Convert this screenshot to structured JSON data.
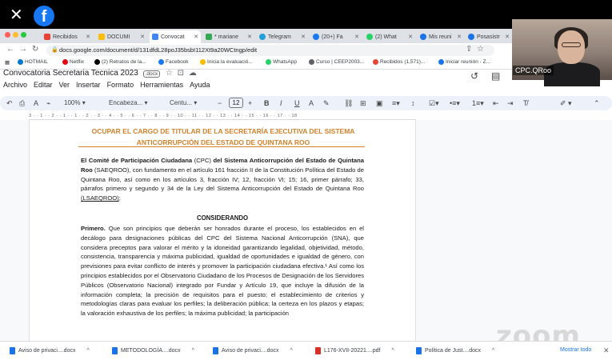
{
  "overlay": {
    "close": "✕",
    "fb_logo": "f"
  },
  "tabs": [
    {
      "label": "Recibidos",
      "color": "#ea4335"
    },
    {
      "label": "DOCUMI",
      "color": "#fbbc04"
    },
    {
      "label": "Convocat",
      "color": "#4285f4",
      "active": true
    },
    {
      "label": "* mariane",
      "color": "#34a853"
    },
    {
      "label": "Telegram",
      "color": "#229ed9"
    },
    {
      "label": "(20+) Fa",
      "color": "#1877f2"
    },
    {
      "label": "(2) What",
      "color": "#25d366"
    },
    {
      "label": "Mis reuni",
      "color": "#1a73e8"
    },
    {
      "label": "Posasistr",
      "color": "#1a73e8"
    }
  ],
  "address": {
    "url": "docs.google.com/document/d/131dfdL28poJ35bsbI112Xt9a20WCtngp/edit"
  },
  "bookmarks": [
    {
      "label": "HOTMAIL",
      "color": "#0078d4"
    },
    {
      "label": "Netflix",
      "color": "#e50914"
    },
    {
      "label": "(2) Retratos de la...",
      "color": "#000000"
    },
    {
      "label": "Facebook",
      "color": "#1877f2"
    },
    {
      "label": "Inicia la evaluació...",
      "color": "#fbbc04"
    },
    {
      "label": "WhatsApp",
      "color": "#25d366"
    },
    {
      "label": "Curso | CEEP2003...",
      "color": "#5f6368"
    },
    {
      "label": "Recibidos (1,571)...",
      "color": "#ea4335"
    },
    {
      "label": "Iniciar reunión - Z...",
      "color": "#1a73e8"
    }
  ],
  "webcam": {
    "name": "CPC.QRoo"
  },
  "docs": {
    "title": "Convocatoria Secretaria Tecnica 2023",
    "badge": ".docx",
    "menu": [
      "Archivo",
      "Editar",
      "Ver",
      "Insertar",
      "Formato",
      "Herramientas",
      "Ayuda"
    ]
  },
  "toolbar": {
    "zoom": "100%",
    "style": "Encabeza...",
    "font": "Centu...",
    "font_size": "12"
  },
  "ruler": "3 · · 1 · · 2 · · 1 · · 1 · · 2 · · 3 · · 4 · · 5 · · 6 · · 7 · · 8 · · 9 · · 10 · · 11 · · 12 · · 13 · · 14 · · 15 · · 16 · · 17 · · 18",
  "document": {
    "heading": "OCUPAR EL CARGO DE TITULAR DE LA SECRETARÍA EJECUTIVA DEL SISTEMA ANTICORRUPCIÓN DEL ESTADO DE QUINTANA ROO",
    "p1_bold": "El Comité de Participación Ciudadana",
    "p1_a": " (CPC) ",
    "p1_bold2": "del Sistema Anticorrupción del Estado de Quintana Roo",
    "p1_b": " (SAEQROO), con fundamento en el artículo 161 fracción II de la Constitución Política del Estado de Quintana Roo, así como en los artículos 3, fracción IV; 12, fracción VI; 15; 16, primer párrafo; 33, párrafos primero y segundo y 34 de la Ley del Sistema Anticorrupción del Estado de Quintana Roo ",
    "p1_ul": "(LSAEQROO)",
    "p1_end": ";",
    "considerando": "CONSIDERANDO",
    "p2_bold": "Primero.",
    "p2": " Que son principios que deberán ser honrados durante el proceso, los establecidos en el decálogo para designaciones públicas del CPC del Sistema Nacional Anticorrupción (SNA), que considera preceptos para valorar el mérito y la idoneidad garantizando legalidad, objetividad, método, consistencia, transparencia y máxima publicidad, igualdad de oportunidades e igualdad de género, con previsiones para evitar conflicto de interés y promover la participación ciudadana efectiva.¹ Así como los principios establecidos por el Observatorio Ciudadano de los Procesos de Designación de los Servidores Públicos (Observatorio Nacional) integrado por Fundar y Artículo 19, que incluye la difusión de la información completa; la precisión de requisitos para el puesto; el establecimiento de criterios y metodologías claras para evaluar los perfiles; la deliberación pública; la certeza en los plazos y etapas; la valoración exhaustiva de los perfiles; la máxima publicidad; la participación"
  },
  "watermark": "zoom",
  "downloads": {
    "items": [
      "Aviso de privaci....docx",
      "METODOLOGÍA....docx",
      "Aviso de privaci....docx",
      "L176-XVII-20221....pdf",
      "Política de Just....docx"
    ],
    "show_all": "Mostrar todo",
    "close": "✕"
  }
}
